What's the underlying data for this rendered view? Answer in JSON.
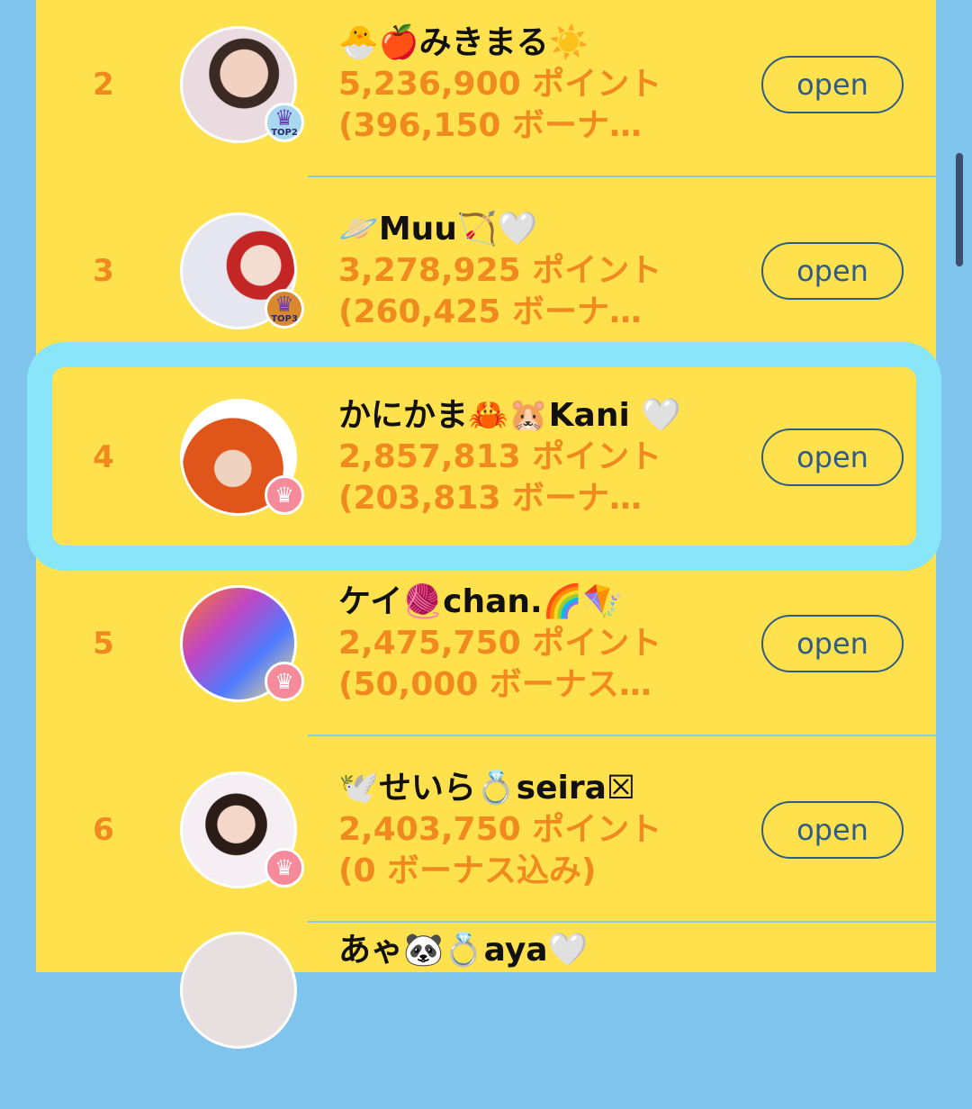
{
  "button_label": "open",
  "rows": [
    {
      "rank": "2",
      "name": "🐣🍎みきまる☀️",
      "points": "5,236,900 ポイント",
      "bonus": "(396,150 ボーナ…",
      "badge": "TOP2"
    },
    {
      "rank": "3",
      "name": "🪐Muu🏹🤍",
      "points": "3,278,925 ポイント",
      "bonus": "(260,425 ボーナ…",
      "badge": "TOP3"
    },
    {
      "rank": "4",
      "name": "かにかま🦀🐹Kani 🤍",
      "points": "2,857,813 ポイント",
      "bonus": "(203,813 ボーナ…",
      "badge": ""
    },
    {
      "rank": "5",
      "name": "ケイ🧶chan.🌈🪁",
      "points": "2,475,750 ポイント",
      "bonus": "(50,000 ボーナス…",
      "badge": ""
    },
    {
      "rank": "6",
      "name": "🕊️せいら💍seira☒",
      "points": "2,403,750 ポイント",
      "bonus": "(0 ボーナス込み)",
      "badge": ""
    },
    {
      "rank": "",
      "name": "あゃ🐼💍aya🤍",
      "points": "",
      "bonus": "",
      "badge": ""
    }
  ],
  "highlighted_rank": "4",
  "colors": {
    "page_background": "#7fc4ec",
    "panel": "#ffe04d",
    "rank_and_points": "#f08a1e",
    "button_border": "#2f5c85",
    "highlight_border": "#88e6f8",
    "divider": "#8fc8e8"
  },
  "icons": {
    "rank_badge": "crown-icon"
  }
}
